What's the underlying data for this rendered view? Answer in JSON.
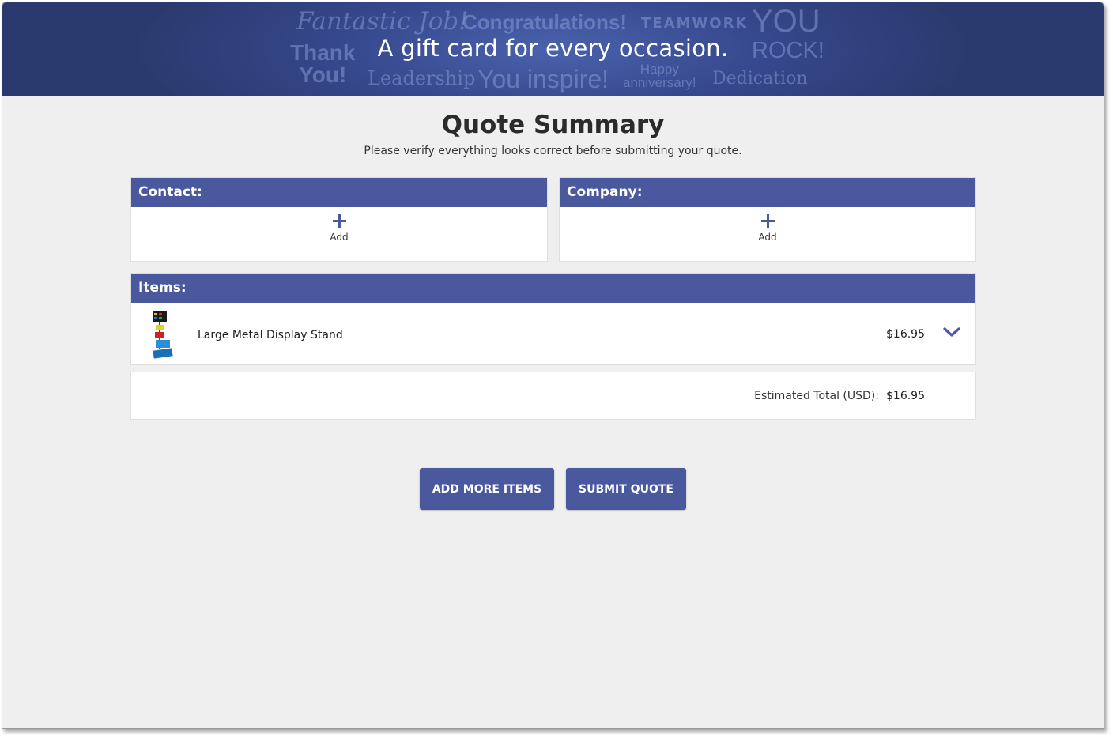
{
  "banner": {
    "headline": "A gift card for every occasion.",
    "background_words": {
      "fantastic": "Fantastic Job!",
      "congratulations": "Congratulations!",
      "teamwork": "TEAMWORK",
      "you": "YOU",
      "thank": "Thank",
      "thank_you": "You!",
      "rock": "ROCK!",
      "leadership": "Leadership",
      "inspire": "You inspire!",
      "happy": "Happy",
      "anniversary": "anniversary!",
      "dedication": "Dedication"
    }
  },
  "page": {
    "title": "Quote Summary",
    "subtitle": "Please verify everything looks correct before submitting your quote."
  },
  "contact": {
    "heading": "Contact:",
    "add_label": "Add",
    "icon": "plus-icon"
  },
  "company": {
    "heading": "Company:",
    "add_label": "Add",
    "icon": "plus-icon"
  },
  "items": {
    "heading": "Items:",
    "rows": [
      {
        "name": "Large Metal Display Stand",
        "price": "$16.95",
        "thumbnail": "display-stand-thumbnail",
        "expand_icon": "chevron-down-icon"
      }
    ]
  },
  "totals": {
    "label": "Estimated Total (USD):",
    "value": "$16.95"
  },
  "actions": {
    "add_more": "ADD MORE ITEMS",
    "submit": "SUBMIT QUOTE"
  },
  "colors": {
    "accent": "#4a599e",
    "page_background": "#efefef",
    "banner": "#35468a"
  }
}
